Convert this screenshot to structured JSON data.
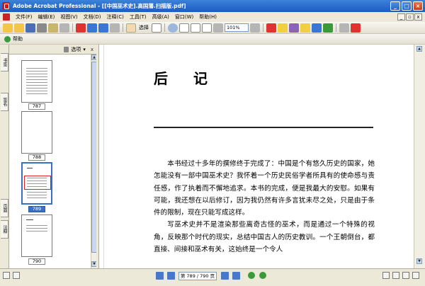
{
  "window": {
    "title": "Adobe Acrobat Professional - [[中国巫术史].高国藩.扫描版.pdf]",
    "controls": [
      "_",
      "□",
      "×"
    ]
  },
  "menubar": {
    "items": [
      "文件(F)",
      "编辑(E)",
      "视图(V)",
      "文档(D)",
      "注释(C)",
      "工具(T)",
      "高级(A)",
      "窗口(W)",
      "帮助(H)"
    ],
    "doc_controls": [
      "_",
      "▫",
      "x"
    ]
  },
  "toolbar": {
    "select_label": "选择",
    "zoom_value": "101%",
    "help_label": "帮助"
  },
  "nav_tabs": [
    "书签",
    "签名",
    "页面",
    "注释"
  ],
  "thumbnails": {
    "options_label": "选项",
    "close": "x",
    "items": [
      {
        "label": "787",
        "selected": false
      },
      {
        "label": "788",
        "selected": false
      },
      {
        "label": "789",
        "selected": true
      },
      {
        "label": "790",
        "selected": false
      }
    ]
  },
  "document": {
    "heading": "后记",
    "paragraphs": [
      "本书经过十多年的撰修终于完成了：中国是个有悠久历史的国家，她怎能没有一部中国巫术史？我怀着一个历史民俗学者所具有的使命感与责任感，作了执着而不懈地追求。本书的完成，便是我最大的安慰。如果有可能，我还想在以后修订，因为我仍然有许多言犹未尽之处，只是由于条件的限制，现在只能写成这样。",
      "写巫术史并不是渲染那些离奇古怪的巫术，而是通过一个特殊的视角，反映那个时代的现实，总结中国古人的历史教训。一个王朝倒台，都直接、间接和巫术有关，这始终是一个令人"
    ]
  },
  "statusbar": {
    "page_indicator": "第 789 / 790 页"
  }
}
